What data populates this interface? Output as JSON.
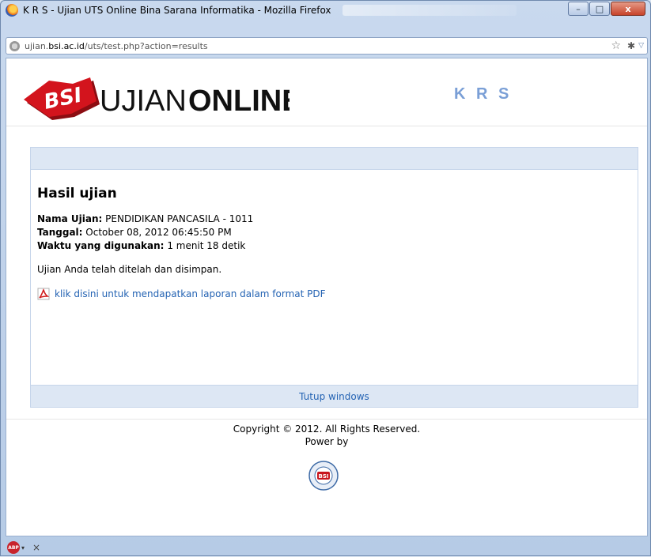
{
  "window": {
    "title": "K R S - Ujian UTS Online Bina Sarana Informatika - Mozilla Firefox",
    "buttons": {
      "minimize": "–",
      "maximize": "□",
      "close": "x"
    }
  },
  "urlbar": {
    "url_prefix": "ujian.",
    "url_domain": "bsi.ac.id",
    "url_path": "/uts/test.php?action=results",
    "bookmark_icon": "☆",
    "extension_icon": "✱",
    "dropdown_icon": "▽"
  },
  "header": {
    "logo_text_light": "UJIAN",
    "logo_text_bold": "ONLINE",
    "logo_mark": "BSI",
    "section": "K R S"
  },
  "result": {
    "heading": "Hasil ujian",
    "exam_label": "Nama Ujian:",
    "exam_value": "PENDIDIKAN PANCASILA - 1011",
    "date_label": "Tanggal:",
    "date_value": "October 08, 2012 06:45:50 PM",
    "duration_label": "Waktu yang digunakan:",
    "duration_value": "1 menit 18 detik",
    "message": "Ujian Anda telah ditelah dan disimpan.",
    "pdf_link": "klik disini untuk mendapatkan laporan dalam format PDF",
    "close_link": "Tutup windows"
  },
  "footer": {
    "copyright": "Copyright © 2012. All Rights Reserved.",
    "power_by": "Power by",
    "seal_ring_text": "BINA SARANA INFORMATIKA",
    "seal_center": "BSI"
  },
  "statusbar": {
    "abp_label": "ABP",
    "abp_dropdown": "▾",
    "close_icon": "×"
  },
  "colors": {
    "link": "#2463b3",
    "section_title": "#7a9fd6",
    "panel_band": "#dde7f4",
    "logo_red": "#c8141c"
  }
}
